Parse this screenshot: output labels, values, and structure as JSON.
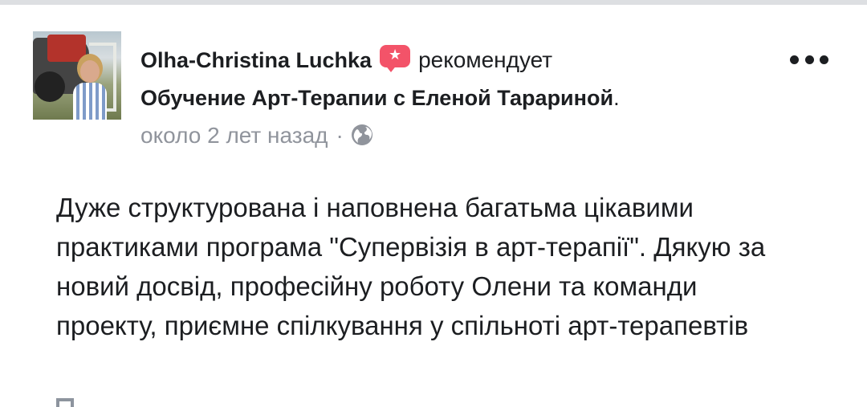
{
  "post": {
    "author": "Olha-Christina Luchka",
    "verb": "рекомендует",
    "page_name": "Обучение Арт-Терапии с Еленой Тарариной",
    "page_suffix": ".",
    "timestamp": "около 2 лет назад",
    "separator": "·",
    "privacy_icon": "globe-icon",
    "recommend_icon": "star-bubble-icon",
    "menu_icon": "more-options-icon",
    "body": "Дуже структурована і наповнена багатьма цікавими практиками програма \"Супервізія в арт-терапії\". Дякую за новий досвід, професійну роботу Олени та команди проекту, приємне спілкування у спільноті арт-терапевтів"
  },
  "colors": {
    "text_primary": "#1c1e21",
    "text_secondary": "#90949c",
    "recommend_accent": "#f35369",
    "top_strip": "#dddfe2"
  }
}
